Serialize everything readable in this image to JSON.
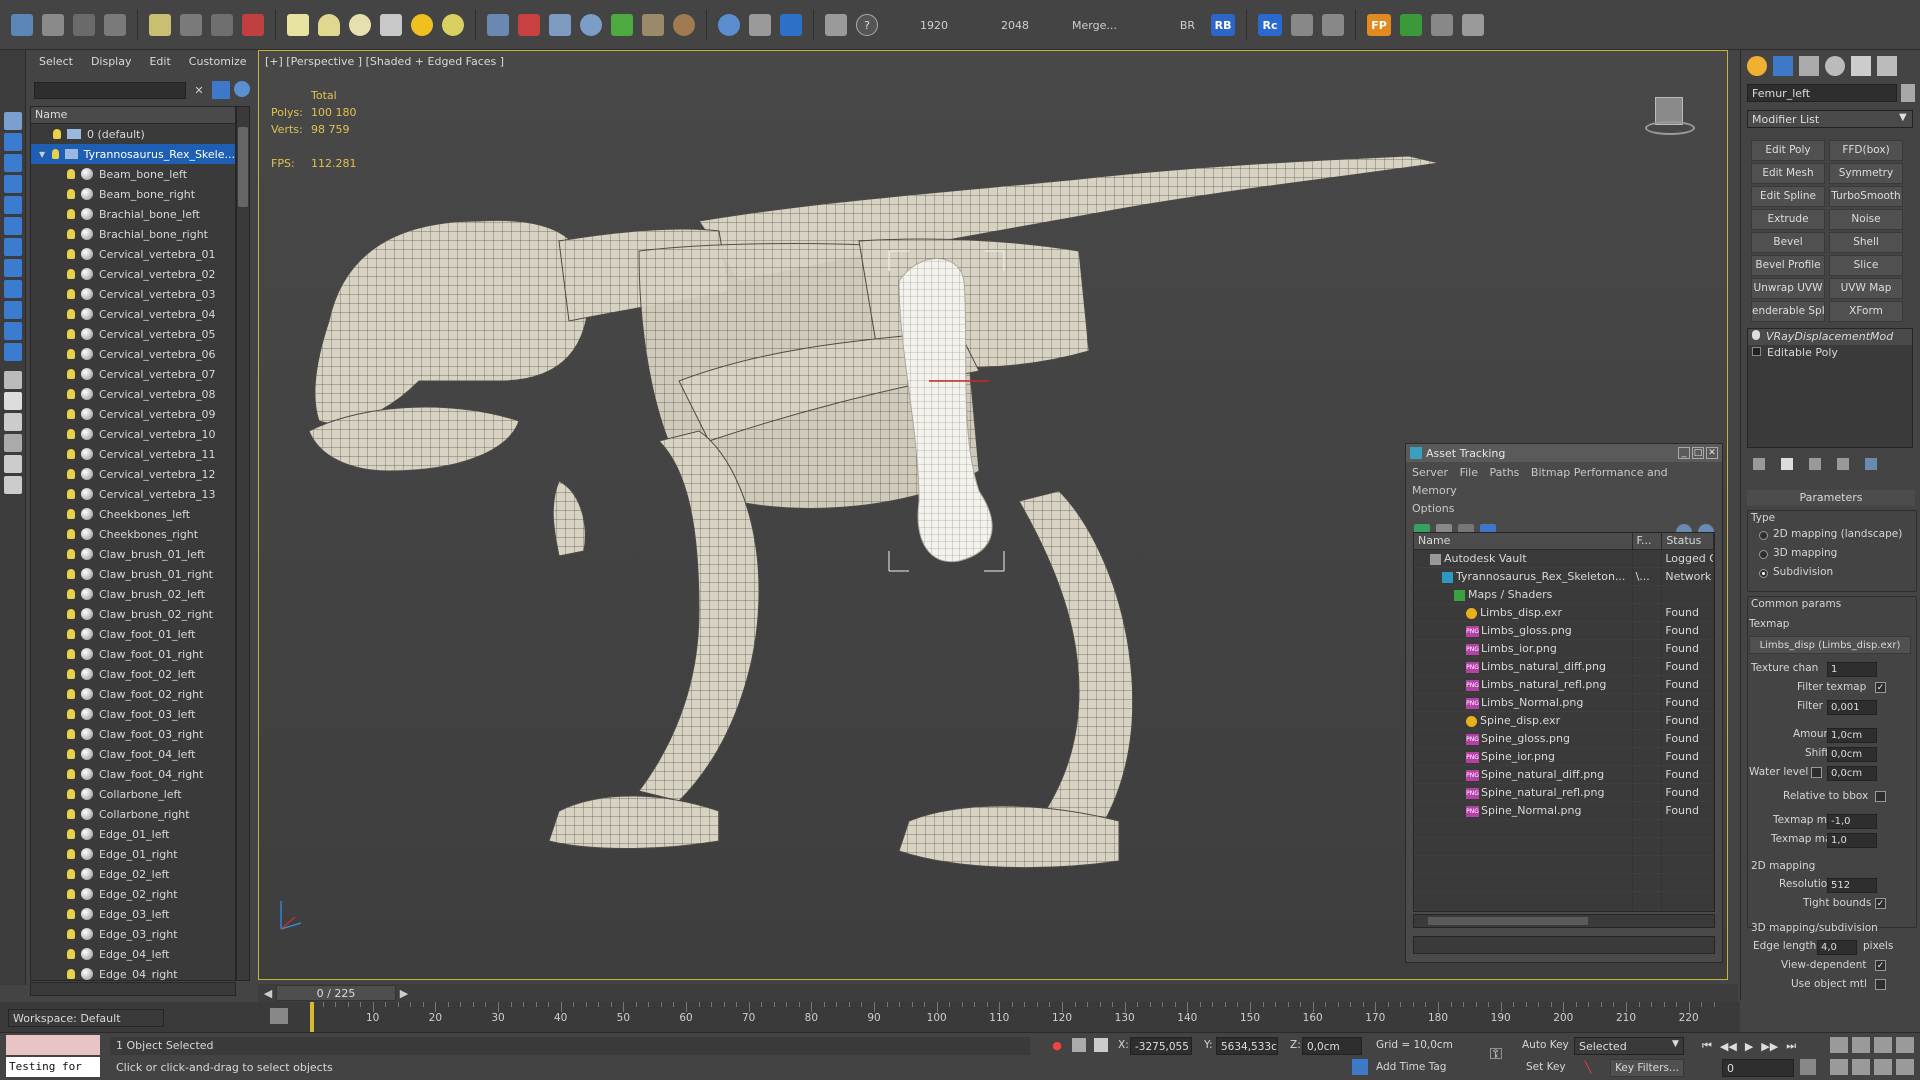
{
  "toolbar": {
    "items": [
      "1920",
      "2048",
      "Merge...",
      "BR",
      "RB",
      "Rc",
      "FP"
    ]
  },
  "explorer": {
    "menu": [
      "Select",
      "Display",
      "Edit",
      "Customize"
    ],
    "column": "Name",
    "rows": [
      {
        "label": "0 (default)",
        "indent": 1,
        "type": "layer"
      },
      {
        "label": "Tyrannosaurus_Rex_Skele...",
        "indent": 1,
        "type": "layer",
        "selected": true
      },
      {
        "label": "Beam_bone_left",
        "indent": 2
      },
      {
        "label": "Beam_bone_right",
        "indent": 2
      },
      {
        "label": "Brachial_bone_left",
        "indent": 2
      },
      {
        "label": "Brachial_bone_right",
        "indent": 2
      },
      {
        "label": "Cervical_vertebra_01",
        "indent": 2
      },
      {
        "label": "Cervical_vertebra_02",
        "indent": 2
      },
      {
        "label": "Cervical_vertebra_03",
        "indent": 2
      },
      {
        "label": "Cervical_vertebra_04",
        "indent": 2
      },
      {
        "label": "Cervical_vertebra_05",
        "indent": 2
      },
      {
        "label": "Cervical_vertebra_06",
        "indent": 2
      },
      {
        "label": "Cervical_vertebra_07",
        "indent": 2
      },
      {
        "label": "Cervical_vertebra_08",
        "indent": 2
      },
      {
        "label": "Cervical_vertebra_09",
        "indent": 2
      },
      {
        "label": "Cervical_vertebra_10",
        "indent": 2
      },
      {
        "label": "Cervical_vertebra_11",
        "indent": 2
      },
      {
        "label": "Cervical_vertebra_12",
        "indent": 2
      },
      {
        "label": "Cervical_vertebra_13",
        "indent": 2
      },
      {
        "label": "Cheekbones_left",
        "indent": 2
      },
      {
        "label": "Cheekbones_right",
        "indent": 2
      },
      {
        "label": "Claw_brush_01_left",
        "indent": 2
      },
      {
        "label": "Claw_brush_01_right",
        "indent": 2
      },
      {
        "label": "Claw_brush_02_left",
        "indent": 2
      },
      {
        "label": "Claw_brush_02_right",
        "indent": 2
      },
      {
        "label": "Claw_foot_01_left",
        "indent": 2
      },
      {
        "label": "Claw_foot_01_right",
        "indent": 2
      },
      {
        "label": "Claw_foot_02_left",
        "indent": 2
      },
      {
        "label": "Claw_foot_02_right",
        "indent": 2
      },
      {
        "label": "Claw_foot_03_left",
        "indent": 2
      },
      {
        "label": "Claw_foot_03_right",
        "indent": 2
      },
      {
        "label": "Claw_foot_04_left",
        "indent": 2
      },
      {
        "label": "Claw_foot_04_right",
        "indent": 2
      },
      {
        "label": "Collarbone_left",
        "indent": 2
      },
      {
        "label": "Collarbone_right",
        "indent": 2
      },
      {
        "label": "Edge_01_left",
        "indent": 2
      },
      {
        "label": "Edge_01_right",
        "indent": 2
      },
      {
        "label": "Edge_02_left",
        "indent": 2
      },
      {
        "label": "Edge_02_right",
        "indent": 2
      },
      {
        "label": "Edge_03_left",
        "indent": 2
      },
      {
        "label": "Edge_03_right",
        "indent": 2
      },
      {
        "label": "Edge_04_left",
        "indent": 2
      },
      {
        "label": "Edge_04_right",
        "indent": 2
      }
    ],
    "workspace": "Workspace: Default"
  },
  "viewport": {
    "label": "[+] [Perspective ] [Shaded + Edged Faces ]",
    "stats": {
      "header": "Total",
      "polys_label": "Polys:",
      "polys": "100 180",
      "verts_label": "Verts:",
      "verts": "98 759",
      "fps_label": "FPS:",
      "fps": "112.281"
    }
  },
  "asset_tracking": {
    "title": "Asset Tracking",
    "menu": [
      "Server",
      "File",
      "Paths",
      "Bitmap Performance and Memory",
      "Options"
    ],
    "columns": [
      "Name",
      "F...",
      "Status"
    ],
    "rows": [
      {
        "name": "Autodesk Vault",
        "f": "",
        "status": "Logged Ou",
        "kind": "vault",
        "indent": 1
      },
      {
        "name": "Tyrannosaurus_Rex_Skeleton...",
        "f": "\\...",
        "status": "Network P",
        "kind": "max",
        "indent": 2
      },
      {
        "name": "Maps / Shaders",
        "f": "",
        "status": "",
        "kind": "folder",
        "indent": 3
      },
      {
        "name": "Limbs_disp.exr",
        "f": "",
        "status": "Found",
        "kind": "exr",
        "indent": 4
      },
      {
        "name": "Limbs_gloss.png",
        "f": "",
        "status": "Found",
        "kind": "png",
        "indent": 4
      },
      {
        "name": "Limbs_ior.png",
        "f": "",
        "status": "Found",
        "kind": "png",
        "indent": 4
      },
      {
        "name": "Limbs_natural_diff.png",
        "f": "",
        "status": "Found",
        "kind": "png",
        "indent": 4
      },
      {
        "name": "Limbs_natural_refl.png",
        "f": "",
        "status": "Found",
        "kind": "png",
        "indent": 4
      },
      {
        "name": "Limbs_Normal.png",
        "f": "",
        "status": "Found",
        "kind": "png",
        "indent": 4
      },
      {
        "name": "Spine_disp.exr",
        "f": "",
        "status": "Found",
        "kind": "exr",
        "indent": 4
      },
      {
        "name": "Spine_gloss.png",
        "f": "",
        "status": "Found",
        "kind": "png",
        "indent": 4
      },
      {
        "name": "Spine_ior.png",
        "f": "",
        "status": "Found",
        "kind": "png",
        "indent": 4
      },
      {
        "name": "Spine_natural_diff.png",
        "f": "",
        "status": "Found",
        "kind": "png",
        "indent": 4
      },
      {
        "name": "Spine_natural_refl.png",
        "f": "",
        "status": "Found",
        "kind": "png",
        "indent": 4
      },
      {
        "name": "Spine_Normal.png",
        "f": "",
        "status": "Found",
        "kind": "png",
        "indent": 4
      }
    ]
  },
  "modify_panel": {
    "object_name": "Femur_left",
    "modifier_list": "Modifier List",
    "buttons": [
      [
        "Edit Poly",
        "FFD(box)"
      ],
      [
        "Edit Mesh",
        "Symmetry"
      ],
      [
        "Edit Spline",
        "TurboSmooth"
      ],
      [
        "Extrude",
        "Noise"
      ],
      [
        "Bevel",
        "Shell"
      ],
      [
        "Bevel Profile",
        "Slice"
      ],
      [
        "Unwrap UVW",
        "UVW Map"
      ],
      [
        "enderable Splir",
        "XForm"
      ]
    ],
    "stack": [
      "VRayDisplacementMod",
      "Editable Poly"
    ],
    "parameters": {
      "rollout": "Parameters",
      "type_label": "Type",
      "types": [
        "2D mapping (landscape)",
        "3D mapping",
        "Subdivision"
      ],
      "common_label": "Common params",
      "texmap_label": "Texmap",
      "texmap_value": "Limbs_disp (Limbs_disp.exr)",
      "texture_chan_label": "Texture chan",
      "texture_chan": "1",
      "filter_texmap_label": "Filter texmap",
      "filter_blur_label": "Filter blur",
      "filter_blur": "0,001",
      "amount_label": "Amount",
      "amount": "1,0cm",
      "shift_label": "Shift",
      "shift": "0,0cm",
      "water_label": "Water level",
      "water": "0,0cm",
      "relative_label": "Relative to bbox",
      "texmin_label": "Texmap min",
      "texmin": "-1,0",
      "texmax_label": "Texmap max",
      "texmax": "1,0",
      "map2d_label": "2D mapping",
      "resolution_label": "Resolution",
      "resolution": "512",
      "tight_label": "Tight bounds",
      "map3d_label": "3D mapping/subdivision",
      "edge_label": "Edge length",
      "edge": "4,0",
      "pixels": "pixels",
      "viewdep_label": "View-dependent",
      "useobj_label": "Use object mtl"
    }
  },
  "timeline": {
    "frame": "0 / 225",
    "ticks": [
      0,
      10,
      20,
      30,
      40,
      50,
      60,
      70,
      80,
      90,
      100,
      110,
      120,
      130,
      140,
      150,
      160,
      170,
      180,
      190,
      200,
      210,
      220
    ]
  },
  "status": {
    "maxscript": "Testing for",
    "selected": "1 Object Selected",
    "prompt": "Click or click-and-drag to select objects",
    "x_label": "X:",
    "x": "-3275,055",
    "y_label": "Y:",
    "y": "5634,533c",
    "z_label": "Z:",
    "z": "0,0cm",
    "grid": "Grid = 10,0cm",
    "add_time_tag": "Add Time Tag",
    "auto_key": "Auto Key",
    "set_key": "Set Key",
    "selected_dropdown": "Selected",
    "key_filters": "Key Filters...",
    "frame_value": "0"
  }
}
